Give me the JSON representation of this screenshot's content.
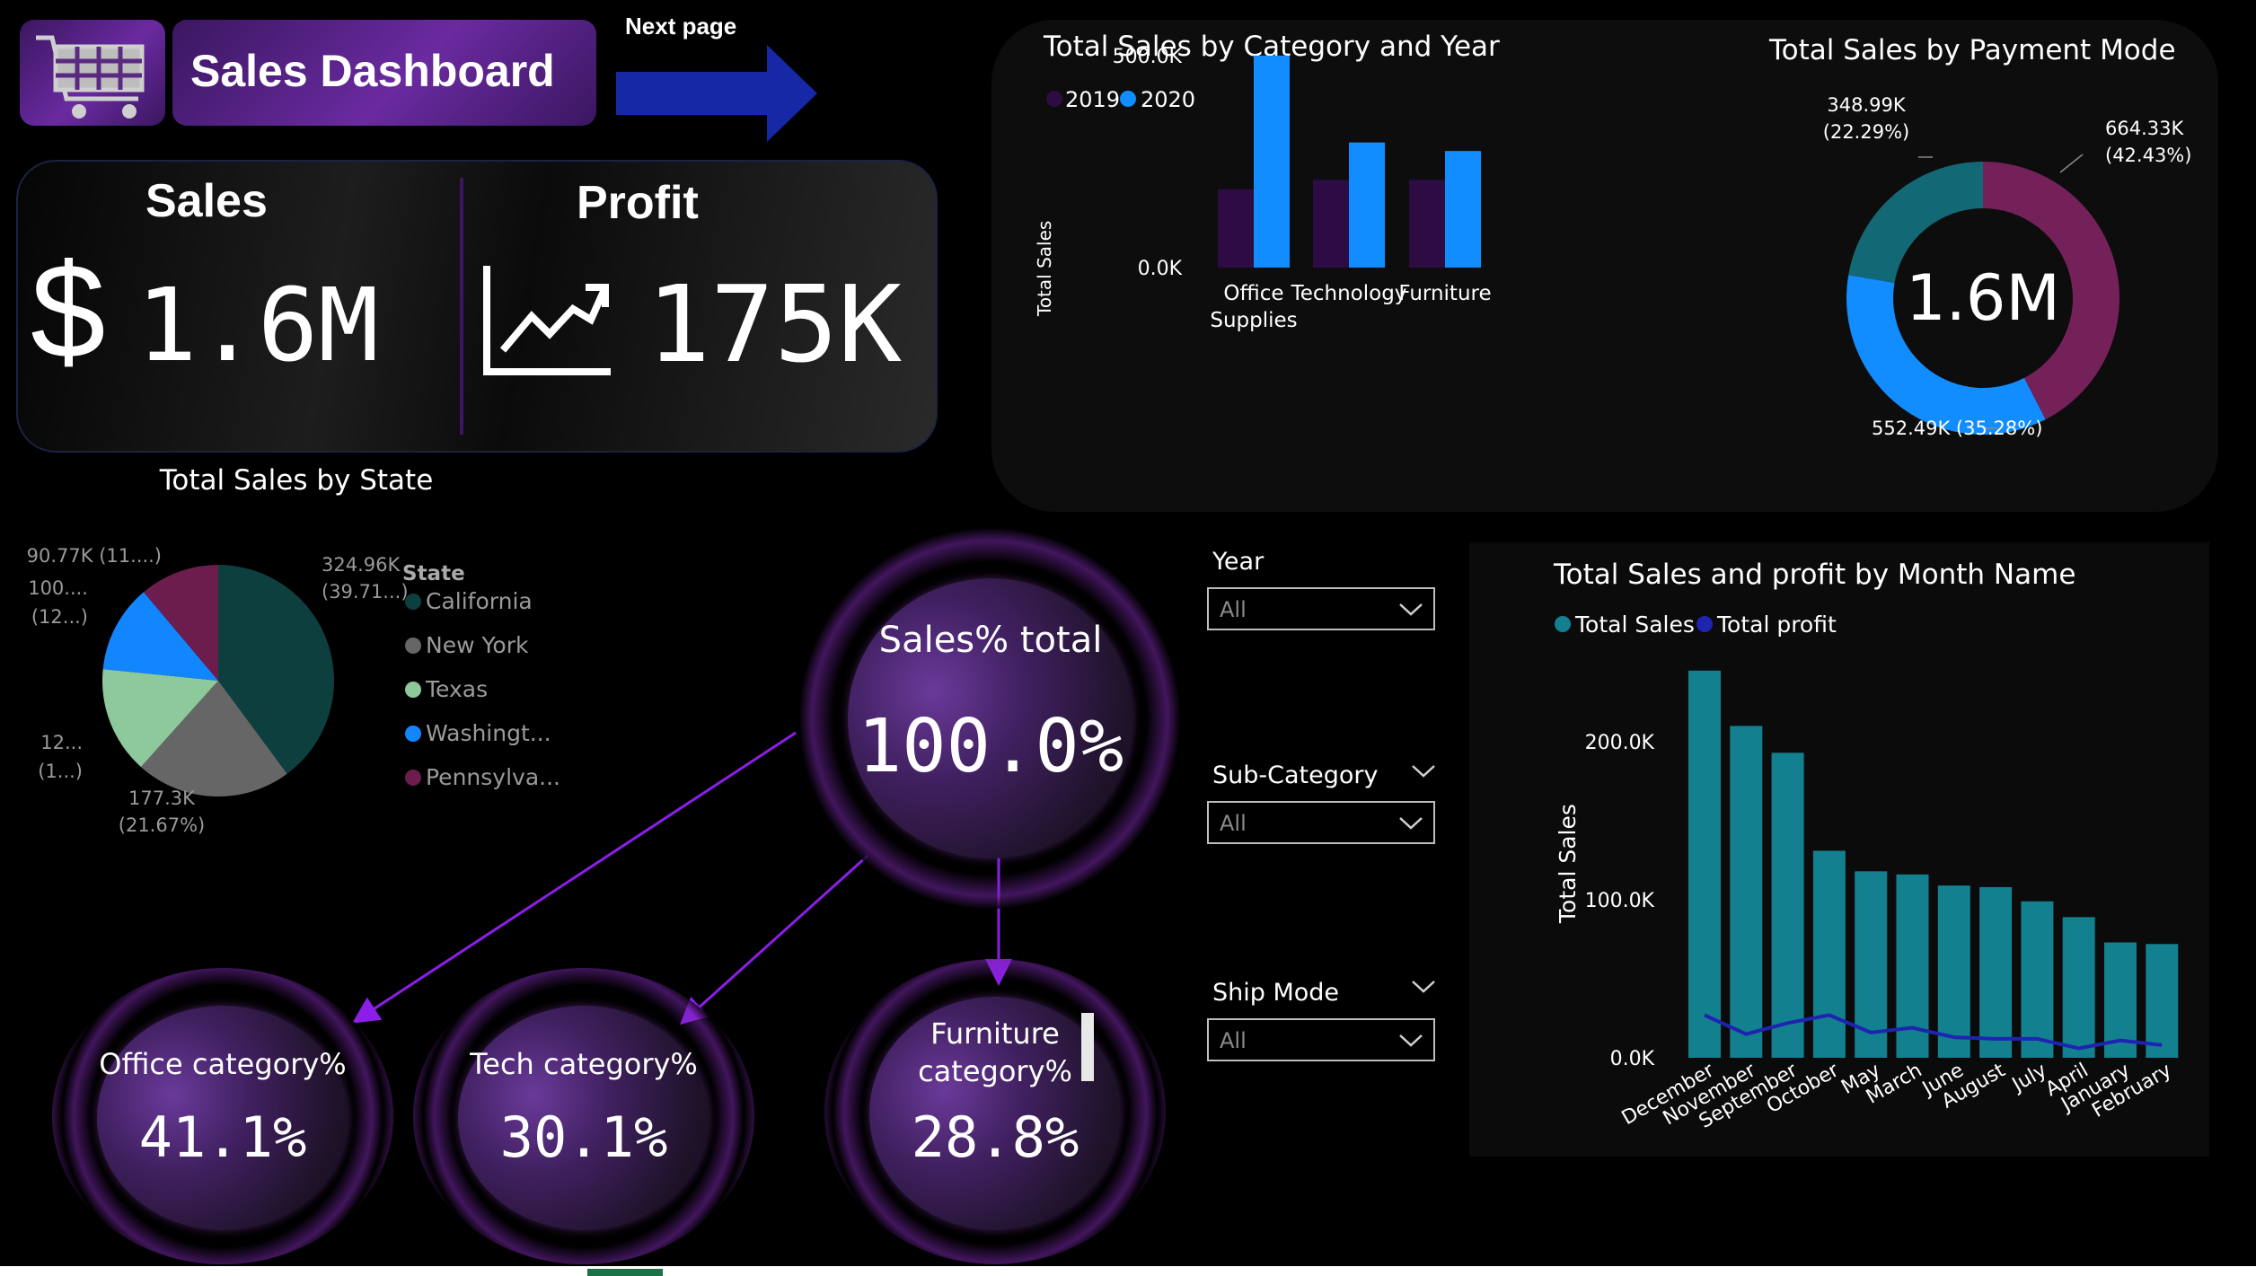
{
  "header": {
    "title": "Sales Dashboard",
    "next_page": "Next page"
  },
  "kpis": {
    "sales_label": "Sales",
    "sales_currency": "$",
    "sales_value": "1.6M",
    "profit_label": "Profit",
    "profit_value": "175K"
  },
  "circles": {
    "total_title": "Sales% total",
    "total_value": "100.0%",
    "office_title": "Office category%",
    "office_value": "41.1%",
    "tech_title": "Tech category%",
    "tech_value": "30.1%",
    "furniture_title_1": "Furniture",
    "furniture_title_2": "category%",
    "furniture_value": "28.8%"
  },
  "slicers": {
    "year_label": "Year",
    "year_value": "All",
    "subcategory_label": "Sub-Category",
    "subcategory_value": "All",
    "shipmode_label": "Ship Mode",
    "shipmode_value": "All"
  },
  "colors": {
    "c2019": "#2d0c44",
    "c2020": "#118dff",
    "teal": "#12808f",
    "profit_line": "#1f24b0",
    "california": "#0e3f3f",
    "newyork": "#666666",
    "texas": "#8dc99a",
    "washington": "#1186ff",
    "pennsylvania": "#6d1d4d",
    "pay_purple": "#74215a",
    "pay_blue": "#118dff",
    "pay_teal": "#136876"
  },
  "chart_data": [
    {
      "type": "bar",
      "title": "Total Sales by Category and Year",
      "ylabel": "Total Sales",
      "categories": [
        "Office Supplies",
        "Technology",
        "Furniture"
      ],
      "category_lines": [
        [
          "Office",
          "Supplies"
        ],
        [
          "Technology"
        ],
        [
          "Furniture"
        ]
      ],
      "series": [
        {
          "name": "2019",
          "values": [
            185000,
            207000,
            207000
          ]
        },
        {
          "name": "2020",
          "values": [
            500000,
            295000,
            275000
          ]
        }
      ],
      "yticks": [
        {
          "v": 0,
          "label": "0.0K"
        },
        {
          "v": 500000,
          "label": "500.0K"
        }
      ],
      "ylim": [
        0,
        540000
      ],
      "legend": "top-left"
    },
    {
      "type": "pie",
      "subtype": "donut",
      "title": "Total Sales by Payment Mode",
      "center_label": "1.6M",
      "slices": [
        {
          "value": 664330,
          "label_1": "664.33K",
          "label_2": "(42.43%)"
        },
        {
          "value": 552490,
          "label_1": "552.49K (35.28%)",
          "label_2": ""
        },
        {
          "value": 348990,
          "label_1": "348.99K",
          "label_2": "(22.29%)"
        }
      ]
    },
    {
      "type": "pie",
      "title": "Total Sales by State",
      "legend_title": "State",
      "slices": [
        {
          "name": "California",
          "value": 324960,
          "label_1": "324.96K",
          "label_2": "(39.71...)"
        },
        {
          "name": "New York",
          "value": 177300,
          "label_1": "177.3K",
          "label_2": "(21.67%)"
        },
        {
          "name": "Texas",
          "value": 122000,
          "label_1": "12...",
          "label_2": "(1...)"
        },
        {
          "name": "Washington",
          "value": 100000,
          "label_1": "100....",
          "label_2": "(12...)"
        },
        {
          "name": "Pennsylvania",
          "value": 90770,
          "label_1": "90.77K (11....)",
          "label_2": ""
        }
      ],
      "legend_labels": [
        "California",
        "New York",
        "Texas",
        "Washingt...",
        "Pennsylva..."
      ]
    },
    {
      "type": "bar",
      "subtype": "bar+line",
      "title": "Total Sales and profit by Month Name",
      "ylabel": "Total Sales",
      "categories": [
        "December",
        "November",
        "September",
        "October",
        "May",
        "March",
        "June",
        "August",
        "July",
        "April",
        "January",
        "February"
      ],
      "series": [
        {
          "name": "Total Sales",
          "values": [
            245000,
            210000,
            193000,
            131000,
            118000,
            116000,
            109000,
            108000,
            99000,
            89000,
            73000,
            72000
          ]
        },
        {
          "name": "Total profit",
          "values": [
            27000,
            15000,
            22000,
            27000,
            16000,
            19000,
            13000,
            12000,
            12000,
            6000,
            11000,
            8000
          ]
        }
      ],
      "yticks": [
        {
          "v": 0,
          "label": "0.0K"
        },
        {
          "v": 100000,
          "label": "100.0K"
        },
        {
          "v": 200000,
          "label": "200.0K"
        }
      ],
      "ylim": [
        0,
        250000
      ],
      "legend": "top-left"
    }
  ]
}
